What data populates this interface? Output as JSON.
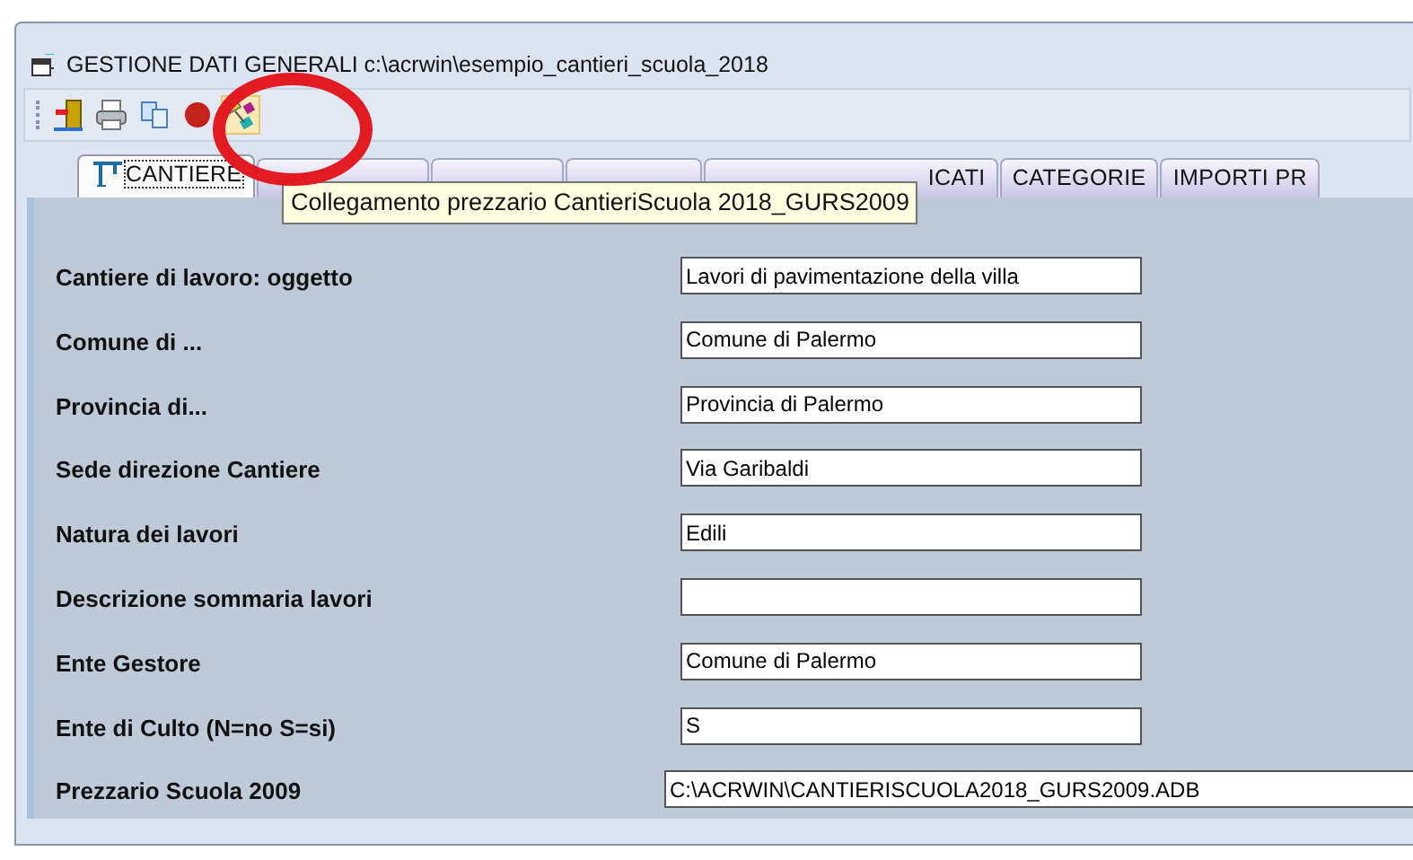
{
  "window": {
    "title": "GESTIONE DATI GENERALI  c:\\acrwin\\esempio_cantieri_scuola_2018"
  },
  "toolbar": [
    {
      "kind": "exit",
      "highlighted": false
    },
    {
      "kind": "print",
      "highlighted": false
    },
    {
      "kind": "copy",
      "highlighted": false
    },
    {
      "kind": "stop",
      "highlighted": false
    },
    {
      "kind": "link",
      "highlighted": true
    }
  ],
  "tabs": [
    {
      "label": "CANTIERE",
      "selected": true
    },
    {
      "selected": false
    },
    {
      "selected": false
    },
    {
      "selected": false
    },
    {
      "label": "ICATI",
      "selected": false
    },
    {
      "label": "CATEGORIE",
      "selected": false
    },
    {
      "label": "IMPORTI PR",
      "selected": false
    }
  ],
  "tooltip": "Collegamento prezzario CantieriScuola 2018_GURS2009",
  "fields": [
    {
      "label": "Cantiere di lavoro: oggetto",
      "value": "Lavori di pavimentazione della villa"
    },
    {
      "label": "Comune di ...",
      "value": "Comune di Palermo"
    },
    {
      "label": "Provincia di...",
      "value": "Provincia di Palermo"
    },
    {
      "label": "Sede direzione Cantiere",
      "value": "Via Garibaldi"
    },
    {
      "label": "Natura dei lavori",
      "value": "Edili"
    },
    {
      "label": "Descrizione sommaria lavori"
    },
    {
      "label": "Ente Gestore",
      "value": "Comune di Palermo"
    },
    {
      "label": "Ente di Culto (N=no  S=si)",
      "value": "S"
    },
    {
      "label": "Prezzario Scuola 2009",
      "value": "C:\\ACRWIN\\CANTIERISCUOLA2018_GURS2009.ADB",
      "wide": true
    }
  ]
}
